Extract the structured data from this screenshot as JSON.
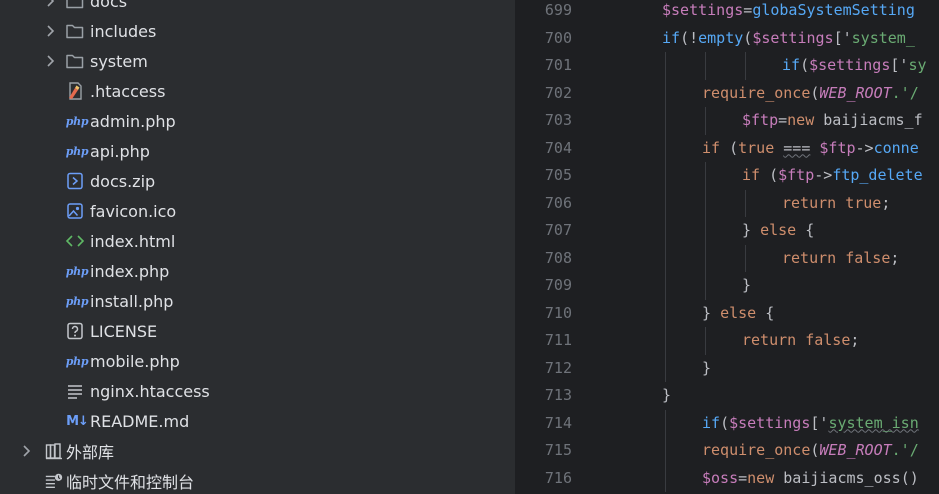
{
  "tree": {
    "items": [
      {
        "label": "docs",
        "type": "folder",
        "expandable": true,
        "depth": 1
      },
      {
        "label": "includes",
        "type": "folder",
        "expandable": true,
        "depth": 1
      },
      {
        "label": "system",
        "type": "folder",
        "expandable": true,
        "depth": 1
      },
      {
        "label": ".htaccess",
        "type": "htaccess",
        "depth": 1
      },
      {
        "label": "admin.php",
        "type": "php",
        "depth": 1
      },
      {
        "label": "api.php",
        "type": "php",
        "depth": 1
      },
      {
        "label": "docs.zip",
        "type": "zip",
        "depth": 1
      },
      {
        "label": "favicon.ico",
        "type": "image",
        "depth": 1
      },
      {
        "label": "index.html",
        "type": "html",
        "depth": 1
      },
      {
        "label": "index.php",
        "type": "php",
        "depth": 1
      },
      {
        "label": "install.php",
        "type": "php",
        "depth": 1
      },
      {
        "label": "LICENSE",
        "type": "unknown",
        "depth": 1
      },
      {
        "label": "mobile.php",
        "type": "php",
        "depth": 1
      },
      {
        "label": "nginx.htaccess",
        "type": "text",
        "depth": 1
      },
      {
        "label": "README.md",
        "type": "markdown",
        "depth": 1
      },
      {
        "label": "外部库",
        "type": "library",
        "expandable": true,
        "depth": 0
      },
      {
        "label": "临时文件和控制台",
        "type": "scratches",
        "depth": 0
      }
    ],
    "icon_text": {
      "php": "php",
      "markdown": "M↓"
    }
  },
  "editor": {
    "lines": [
      {
        "num": "699",
        "indent": 0,
        "tokens": [
          [
            "$settings",
            "v"
          ],
          [
            "=",
            "p"
          ],
          [
            "globaSystemSetting",
            "f"
          ]
        ]
      },
      {
        "num": "700",
        "indent": 0,
        "tokens": [
          [
            "if",
            "f"
          ],
          [
            "(!",
            "p"
          ],
          [
            "empty",
            "f"
          ],
          [
            "(",
            "p"
          ],
          [
            "$settings",
            "v"
          ],
          [
            "['",
            "p"
          ],
          [
            "system_",
            "s"
          ]
        ]
      },
      {
        "num": "701",
        "indent": 3,
        "tokens": [
          [
            "if",
            "f"
          ],
          [
            "(",
            "p"
          ],
          [
            "$settings",
            "v"
          ],
          [
            "['",
            "p"
          ],
          [
            "sy",
            "s"
          ]
        ]
      },
      {
        "num": "702",
        "indent": 1,
        "tokens": [
          [
            "require_once",
            "k"
          ],
          [
            "(",
            "p"
          ],
          [
            "WEB_ROOT",
            "c"
          ],
          [
            ".'/",
            "s"
          ]
        ]
      },
      {
        "num": "703",
        "indent": 2,
        "tokens": [
          [
            "$ftp",
            "v"
          ],
          [
            "=",
            "p"
          ],
          [
            "new ",
            "k"
          ],
          [
            "baijiacms_f",
            "p"
          ]
        ]
      },
      {
        "num": "704",
        "indent": 1,
        "tokens": [
          [
            "if ",
            "k"
          ],
          [
            "(",
            "p"
          ],
          [
            "true ",
            "k"
          ],
          [
            "===",
            "p"
          ],
          [
            " ",
            "p"
          ],
          [
            "$ftp",
            "v"
          ],
          [
            "->",
            "p"
          ],
          [
            "conne",
            "f"
          ]
        ]
      },
      {
        "num": "705",
        "indent": 2,
        "tokens": [
          [
            "if ",
            "k"
          ],
          [
            "(",
            "p"
          ],
          [
            "$ftp",
            "v"
          ],
          [
            "->",
            "p"
          ],
          [
            "ftp_delete",
            "f"
          ]
        ]
      },
      {
        "num": "706",
        "indent": 3,
        "tokens": [
          [
            "return ",
            "k"
          ],
          [
            "true",
            "k"
          ],
          [
            ";",
            "p"
          ]
        ]
      },
      {
        "num": "707",
        "indent": 2,
        "tokens": [
          [
            "} ",
            "p"
          ],
          [
            "else ",
            "k"
          ],
          [
            "{",
            "p"
          ]
        ]
      },
      {
        "num": "708",
        "indent": 3,
        "tokens": [
          [
            "return ",
            "k"
          ],
          [
            "false",
            "k"
          ],
          [
            ";",
            "p"
          ]
        ]
      },
      {
        "num": "709",
        "indent": 2,
        "tokens": [
          [
            "}",
            "p"
          ]
        ]
      },
      {
        "num": "710",
        "indent": 1,
        "tokens": [
          [
            "} ",
            "p"
          ],
          [
            "else ",
            "k"
          ],
          [
            "{",
            "p"
          ]
        ]
      },
      {
        "num": "711",
        "indent": 2,
        "tokens": [
          [
            "return ",
            "k"
          ],
          [
            "false",
            "k"
          ],
          [
            ";",
            "p"
          ]
        ]
      },
      {
        "num": "712",
        "indent": 1,
        "tokens": [
          [
            "}",
            "p"
          ]
        ]
      },
      {
        "num": "713",
        "indent": 0,
        "tokens": [
          [
            "}",
            "p"
          ]
        ]
      },
      {
        "num": "714",
        "indent": 1,
        "tokens": [
          [
            "if",
            "f"
          ],
          [
            "(",
            "p"
          ],
          [
            "$settings",
            "v"
          ],
          [
            "['",
            "p"
          ],
          [
            "system_isn",
            "s"
          ]
        ]
      },
      {
        "num": "715",
        "indent": 1,
        "tokens": [
          [
            "require_once",
            "k"
          ],
          [
            "(",
            "p"
          ],
          [
            "WEB_ROOT",
            "c"
          ],
          [
            ".'/",
            "s"
          ]
        ]
      },
      {
        "num": "716",
        "indent": 1,
        "tokens": [
          [
            "$oss",
            "v"
          ],
          [
            "=",
            "p"
          ],
          [
            "new ",
            "k"
          ],
          [
            "baijiacms_oss",
            "p"
          ],
          [
            "()",
            "p"
          ]
        ]
      }
    ]
  },
  "colors": {
    "tree_bg": "#2b2d30",
    "editor_bg": "#1e1f22",
    "folder_icon": "#9aa0a6",
    "php_icon": "#6c9ef8",
    "html_icon": "#5fb865"
  }
}
